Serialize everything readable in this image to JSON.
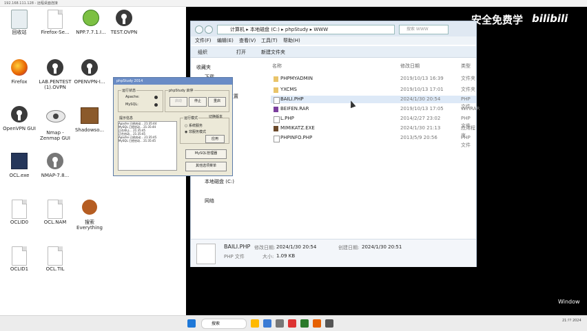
{
  "window": {
    "title": "192.168.111.128 - 远程桌面连接"
  },
  "desktop_icons": [
    {
      "label": "回收站",
      "icon": "recycle-bin-icon"
    },
    {
      "label": "Firefox-Se...",
      "icon": "file-icon"
    },
    {
      "label": "NPP.7.7.1.I...",
      "icon": "notepad-icon"
    },
    {
      "label": "TEST.OVPN",
      "icon": "openvpn-icon"
    },
    {
      "label": "Firefox",
      "icon": "firefox-icon"
    },
    {
      "label": "LAB.PENTEST (1).OVPN",
      "icon": "openvpn-icon"
    },
    {
      "label": "OPENVPN-I...",
      "icon": "openvpn-icon"
    },
    {
      "label": "OpenVPN GUI",
      "icon": "openvpn-icon"
    },
    {
      "label": "Nmap - Zenmap GUI",
      "icon": "eye-icon"
    },
    {
      "label": "Shadowso...",
      "icon": "package-icon"
    },
    {
      "label": "OCL.exe",
      "icon": "exe-icon"
    },
    {
      "label": "NMAP-7.8...",
      "icon": "disc-icon"
    },
    {
      "label": "OCLID0",
      "icon": "file-icon"
    },
    {
      "label": "OCL.NAM",
      "icon": "file-icon"
    },
    {
      "label": "搜索 Everything",
      "icon": "search-icon"
    },
    {
      "label": "OCLID1",
      "icon": "file-icon"
    },
    {
      "label": "OCL.TIL",
      "icon": "file-icon"
    }
  ],
  "phpstudy": {
    "title": "phpStudy 2014",
    "status_group": "运行状态",
    "apache": "Apache:",
    "mysql": "MySQL:",
    "control_group": "phpStudy 启停",
    "start": "启动",
    "stop": "停止",
    "restart": "重启",
    "mode_group": "运行模式",
    "switch_version": "切换版本",
    "mode_system": "系统服务",
    "mode_nonservice": "非服务模式",
    "apply": "应用",
    "log_title": "提示信息",
    "mysql_manager": "MySQL管理器",
    "other_menu": "其他选项菜单",
    "log_lines": [
      "Apache 已经启动...   21:35:44",
      "MySQL 已经启动...    21:35:44",
      "正在停止...          21:35:45",
      "正在启动...          21:35:45",
      "Apache 已经启动...   21:35:45",
      "MySQL 已经启动...    21:35:45"
    ]
  },
  "explorer": {
    "breadcrumb": [
      "计算机",
      "本地磁盘 (C:)",
      "phpStudy",
      "WWW"
    ],
    "search_placeholder": "搜索 WWW",
    "menu": [
      "文件(F)",
      "编辑(E)",
      "查看(V)",
      "工具(T)",
      "帮助(H)"
    ],
    "toolbar": [
      "组织",
      "打开",
      "新建文件夹"
    ],
    "col_name": "名称",
    "col_date": "修改日期",
    "col_type": "类型",
    "sidebar": [
      "收藏夹",
      "下载",
      "桌面",
      "最近访问的位置",
      "本地磁盘 (C:)",
      "网络"
    ],
    "files": [
      {
        "name": "PHPMYADMIN",
        "date": "2019/10/13 16:39",
        "type": "文件夹",
        "kind": "folder"
      },
      {
        "name": "YXCMS",
        "date": "2019/10/13 17:01",
        "type": "文件夹",
        "kind": "folder"
      },
      {
        "name": "BAILI.PHP",
        "date": "2024/1/30 20:54",
        "type": "PHP 文件",
        "kind": "php"
      },
      {
        "name": "BEIFEN.RAR",
        "date": "2019/10/13 17:05",
        "type": "WinRAR",
        "kind": "rar"
      },
      {
        "name": "L.PHP",
        "date": "2014/2/27 23:02",
        "type": "PHP 文件",
        "kind": "php"
      },
      {
        "name": "MIMIKATZ.EXE",
        "date": "2024/1/30 21:13",
        "type": "应用程序",
        "kind": "exe"
      },
      {
        "name": "PHPINFO.PHP",
        "date": "2013/5/9 20:56",
        "type": "PHP 文件",
        "kind": "php"
      }
    ],
    "details": {
      "name": "BAILI.PHP",
      "modified_label": "修改日期:",
      "modified": "2024/1/30 20:54",
      "created_label": "创建日期:",
      "created": "2024/1/30 20:51",
      "type": "PHP 文件",
      "size_label": "大小:",
      "size": "1.09 KB"
    }
  },
  "overlay": {
    "watermark": "安全免费学",
    "logo": "bilibili",
    "activate": "Window"
  },
  "taskbar": {
    "search": "搜索",
    "clock": "21:?? 2024"
  },
  "colors": {
    "explorer_selection": "#dde9f7",
    "phpstudy_bg": "#ece9d8",
    "remote_bg": "#000000"
  }
}
